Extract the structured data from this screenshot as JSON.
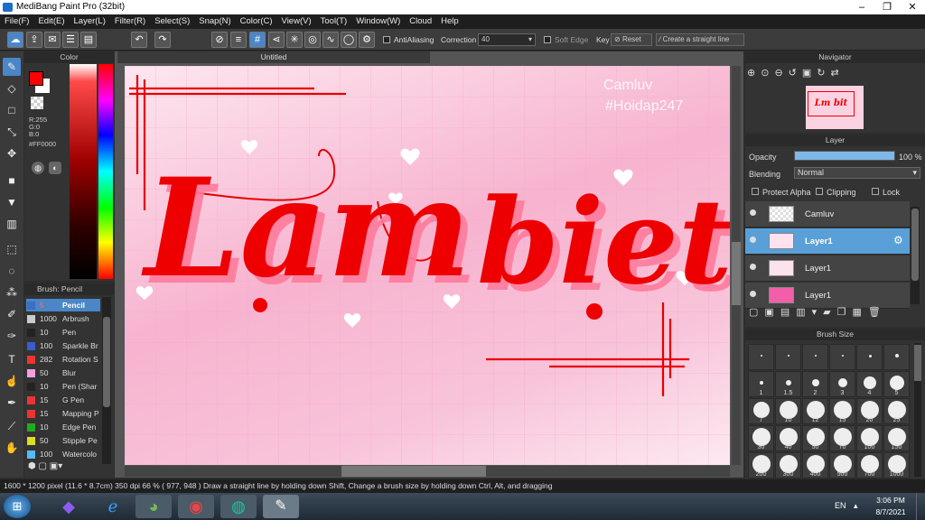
{
  "app": {
    "title": "MediBang Paint Pro (32bit)"
  },
  "menu": [
    "File(F)",
    "Edit(E)",
    "Layer(L)",
    "Filter(R)",
    "Select(S)",
    "Snap(N)",
    "Color(C)",
    "View(V)",
    "Tool(T)",
    "Window(W)",
    "Cloud",
    "Help"
  ],
  "toolbar": {
    "antialiasing_label": "AntiAliasing",
    "correction_label": "Correction",
    "correction_value": "40",
    "soft_edge_label": "Soft Edge",
    "key_label": "Key",
    "reset_label": "Reset",
    "straight_line_label": "Create a straight line"
  },
  "color_panel": {
    "title": "Color",
    "r": "R:255",
    "g": "G:0",
    "b": "B:0",
    "hex": "#FF0000",
    "fg_color": "#FF0000",
    "bg_color": "#FFFFFF"
  },
  "brush_panel": {
    "title": "Brush: Pencil",
    "items": [
      {
        "size": "5",
        "name": "Pencil",
        "color": "#3a6fc5",
        "active": true
      },
      {
        "size": "1000",
        "name": "Arbrush",
        "color": "#cccccc"
      },
      {
        "size": "10",
        "name": "Pen",
        "color": "#222222"
      },
      {
        "size": "100",
        "name": "Sparkle Br",
        "color": "#3a5ccc"
      },
      {
        "size": "282",
        "name": "Rotation S",
        "color": "#ee3333"
      },
      {
        "size": "50",
        "name": "Blur",
        "color": "#f0a0e0"
      },
      {
        "size": "10",
        "name": "Pen (Shar",
        "color": "#222222"
      },
      {
        "size": "15",
        "name": "G Pen",
        "color": "#ee3333"
      },
      {
        "size": "15",
        "name": "Mapping P",
        "color": "#ee3333"
      },
      {
        "size": "10",
        "name": "Edge Pen",
        "color": "#22aa22"
      },
      {
        "size": "50",
        "name": "Stipple Pe",
        "color": "#dddd22"
      },
      {
        "size": "100",
        "name": "Watercolo",
        "color": "#55bbff"
      }
    ]
  },
  "document": {
    "tab_title": "Untitled"
  },
  "artwork": {
    "main_text_left": "Lam",
    "main_text_right": "biet",
    "watermark_line1": "Camluv",
    "watermark_line2": "#Hoidap247"
  },
  "navigator": {
    "title": "Navigator"
  },
  "layer_panel": {
    "title": "Layer",
    "opacity_label": "Opacity",
    "opacity_value": "100 %",
    "blending_label": "Blending",
    "blending_value": "Normal",
    "protect_alpha_label": "Protect Alpha",
    "clipping_label": "Clipping",
    "lock_label": "Lock",
    "layers": [
      {
        "name": "Camluv",
        "active": false
      },
      {
        "name": "Layer1",
        "active": true
      },
      {
        "name": "Layer1",
        "active": false
      },
      {
        "name": "Layer1",
        "active": false
      }
    ]
  },
  "brush_size_panel": {
    "title": "Brush Size",
    "sizes": [
      "",
      "",
      "",
      "",
      "",
      "",
      "1",
      "1.5",
      "2",
      "3",
      "4",
      "5",
      "7",
      "10",
      "12",
      "15",
      "20",
      "25",
      "30",
      "40",
      "50",
      "70",
      "100",
      "150",
      "200",
      "300",
      "400",
      "500",
      "700",
      "1000"
    ]
  },
  "status": {
    "text": "1600 * 1200 pixel   (11.6 * 8.7cm)   350 dpi   66 %   ( 977, 948 )   Draw a straight line by holding down Shift, Change a brush size by holding down Ctrl, Alt, and dragging"
  },
  "taskbar": {
    "lang": "EN",
    "time": "3:06 PM",
    "date": "8/7/2021"
  }
}
